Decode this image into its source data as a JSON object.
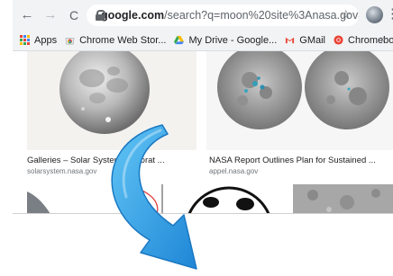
{
  "browser": {
    "nav": {
      "back": "←",
      "forward": "→",
      "reload": "C"
    },
    "url_host": "google.com",
    "url_path": "/search?q=moon%20site%3Anasa.gov&tbm=is...",
    "star": "☆",
    "menu": "⋮"
  },
  "bookmarks": {
    "items": [
      {
        "label": "Apps",
        "icon": "apps-grid-icon"
      },
      {
        "label": "Chrome Web Stor...",
        "icon": "chrome-web-store-icon"
      },
      {
        "label": "My Drive - Google...",
        "icon": "google-drive-icon"
      },
      {
        "label": "GMail",
        "icon": "gmail-icon"
      },
      {
        "label": "Chromebook Clas...",
        "icon": "chromebook-icon"
      }
    ],
    "more": "»"
  },
  "results": [
    {
      "caption": "Galleries – Solar System Explorat",
      "caption_tail": "...",
      "source": "solarsystem.nasa.gov"
    },
    {
      "caption": "NASA Report Outlines Plan for Sustained ...",
      "source": "appel.nasa.gov"
    }
  ],
  "colors": {
    "arrow": "#2f9be9",
    "arrow_light": "#61c5f5",
    "chrome_bg": "#f1f3f4"
  }
}
